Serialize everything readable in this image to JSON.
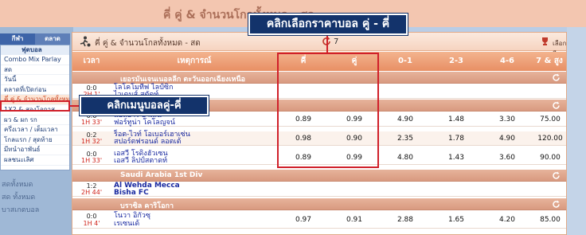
{
  "background_app": {
    "title": "คี่ คู่ & จำนวนโกลทั้งหมด - สด",
    "left_tabs": [
      "กีฬา",
      "ตลาด"
    ],
    "left_rows": [
      "สดทั้งหมด",
      "สด ทั้งหมด",
      "บาสเกตบอล"
    ]
  },
  "sidebar": {
    "header": "ฟุตบอล",
    "items": [
      {
        "label": "Combo Mix Parlay",
        "active": false
      },
      {
        "label": "สด",
        "active": false
      },
      {
        "label": "วันนี้",
        "active": false
      },
      {
        "label": "ตลาดที่เปิดก่อน",
        "active": false
      },
      {
        "label": "คี่ คู่ & จำนวนโกลทั้งหมด",
        "active": true
      },
      {
        "label": "1X2 & สองโอกาส",
        "active": false
      },
      {
        "label": "ผว & ผก รก",
        "active": false
      },
      {
        "label": "ครึ่งเวลา / เต็มเวลา",
        "active": false
      },
      {
        "label": "โกลแรก / สุดท้าย",
        "active": false
      },
      {
        "label": "มีทนำอาพันธ์",
        "active": false
      },
      {
        "label": "ผลชนะเลิศ",
        "active": false
      }
    ]
  },
  "panel": {
    "title": "คี่ คู่ & จำนวนโกลทั้งหมด - สด",
    "count": "7",
    "select_label": "เลือกลีก",
    "columns": [
      "เวลา",
      "เหตุการณ์",
      "คี่",
      "คู่",
      "0-1",
      "2-3",
      "4-6",
      "7 & สูงกว่า"
    ]
  },
  "leagues": [
    {
      "name": "เยอรมันเจนเนอลลีก ตะวันออกเฉียงเหนือ",
      "matches": [
        {
          "score": "0:0",
          "time": "2H 1'",
          "home": "โลโคโมทีฟ ไลป์ซิก",
          "away": "ไวเดนส์ สตัดท์",
          "odd": "",
          "even": "",
          "g01": "",
          "g23": "",
          "g46": "",
          "g7": ""
        }
      ]
    },
    {
      "name": "",
      "matches": [
        {
          "score": "0:0",
          "time": "1H 33'",
          "home": "แอลอาร์ อาเลน",
          "away": "ฟอร์ทูน่า โคโลญจน์",
          "odd": "0.89",
          "even": "0.99",
          "g01": "4.90",
          "g23": "1.48",
          "g46": "3.30",
          "g7": "75.00"
        },
        {
          "score": "0:2",
          "time": "1H 32'",
          "home": "ร็อต-ไวท์ โอเบอร์เฮาเซ่น",
          "away": "สปอร์ตฟรอนด์ ลอตเต้",
          "odd": "0.98",
          "even": "0.90",
          "g01": "2.35",
          "g23": "1.78",
          "g46": "4.90",
          "g7": "120.00"
        },
        {
          "score": "0:0",
          "time": "1H 33'",
          "home": "เอสวี โรดิงฮัวเซน",
          "away": "เอสวี ลิปป์สตาดท์",
          "odd": "0.89",
          "even": "0.99",
          "g01": "4.80",
          "g23": "1.43",
          "g46": "3.60",
          "g7": "90.00"
        }
      ]
    },
    {
      "name": "Saudi Arabia 1st Div",
      "matches": [
        {
          "score": "1:2",
          "time": "2H 44'",
          "home": "Al Wehda Mecca",
          "away": "Bisha FC",
          "odd": "",
          "even": "",
          "g01": "",
          "g23": "",
          "g46": "",
          "g7": ""
        }
      ]
    },
    {
      "name": "บราซิล คาริโอกา",
      "matches": [
        {
          "score": "0:0",
          "time": "1H 4'",
          "home": "โนวา อิกัวซุ",
          "away": "เรเซนเด้",
          "odd": "0.97",
          "even": "0.91",
          "g01": "2.88",
          "g23": "1.65",
          "g46": "4.20",
          "g7": "85.00"
        }
      ]
    }
  ],
  "callouts": {
    "odds_select": "คลิกเลือกราคาบอล คู่ - คี่",
    "menu_select": "คลิกเมนูบอลคู่-คี่"
  },
  "colors": {
    "header_orange": "#e88f64",
    "callout_navy": "#13336b",
    "highlight_red": "#d0202a",
    "team_blue": "#1a2aa0",
    "time_red": "#d0241b"
  }
}
